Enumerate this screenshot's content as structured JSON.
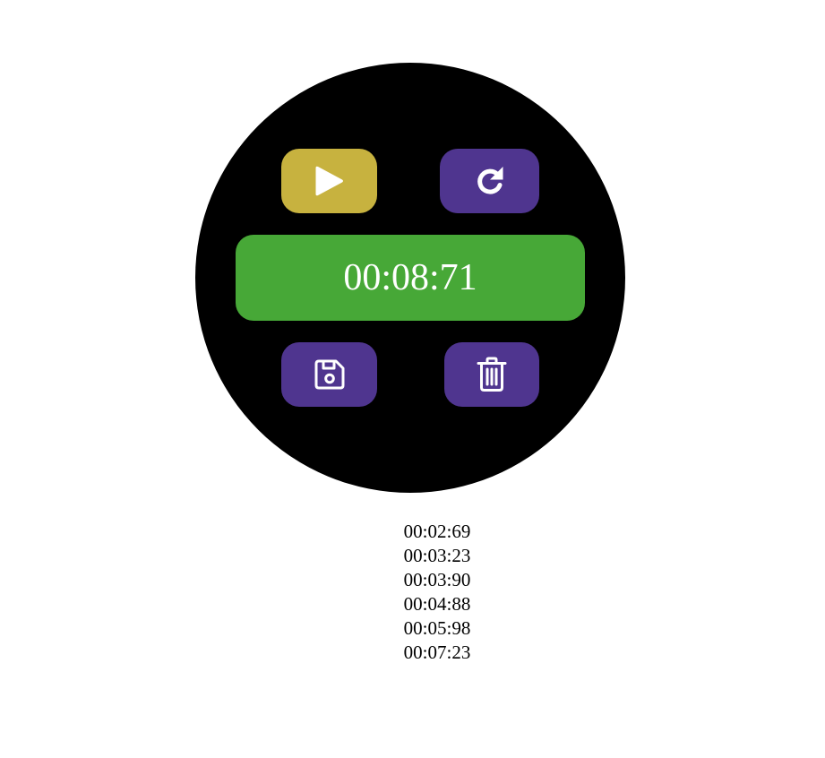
{
  "colors": {
    "face": "#000000",
    "play_button": "#c7b23f",
    "secondary_button": "#4f358f",
    "display": "#47a837",
    "icon": "#ffffff"
  },
  "controls": {
    "play_icon": "play-icon",
    "reset_icon": "redo-arrow-icon",
    "save_icon": "floppy-disk-icon",
    "delete_icon": "trash-icon"
  },
  "timer": {
    "value": "00:08:71"
  },
  "laps": [
    "00:02:69",
    "00:03:23",
    "00:03:90",
    "00:04:88",
    "00:05:98",
    "00:07:23"
  ]
}
